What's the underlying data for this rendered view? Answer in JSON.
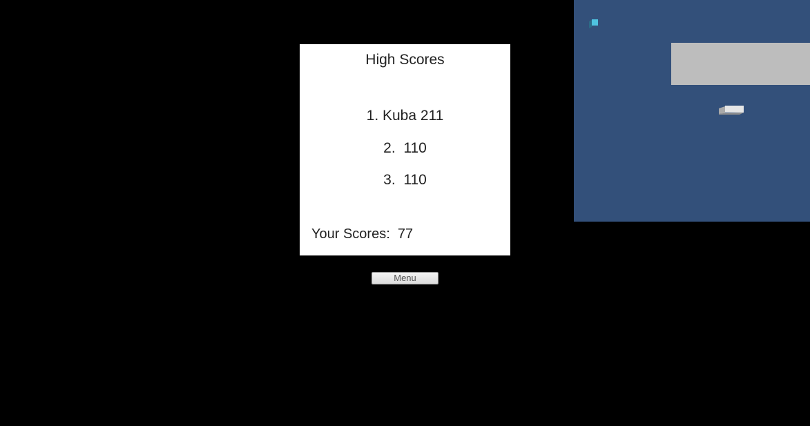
{
  "high_scores": {
    "title": "High Scores",
    "entries": [
      {
        "rank_label": "1.",
        "text": "1. Kuba 211"
      },
      {
        "rank_label": "2.",
        "text": "2.  110"
      },
      {
        "rank_label": "3.",
        "text": "3.  110"
      }
    ],
    "your_score_text": "Your Scores:  77"
  },
  "menu_button": {
    "label": "Menu"
  },
  "preview": {
    "background_color": "#33507a",
    "icon": "cube-icon",
    "icon_color": "#4fc3e0"
  },
  "colors": {
    "background": "#000000",
    "panel": "#ffffff",
    "panel_text": "#222222"
  }
}
